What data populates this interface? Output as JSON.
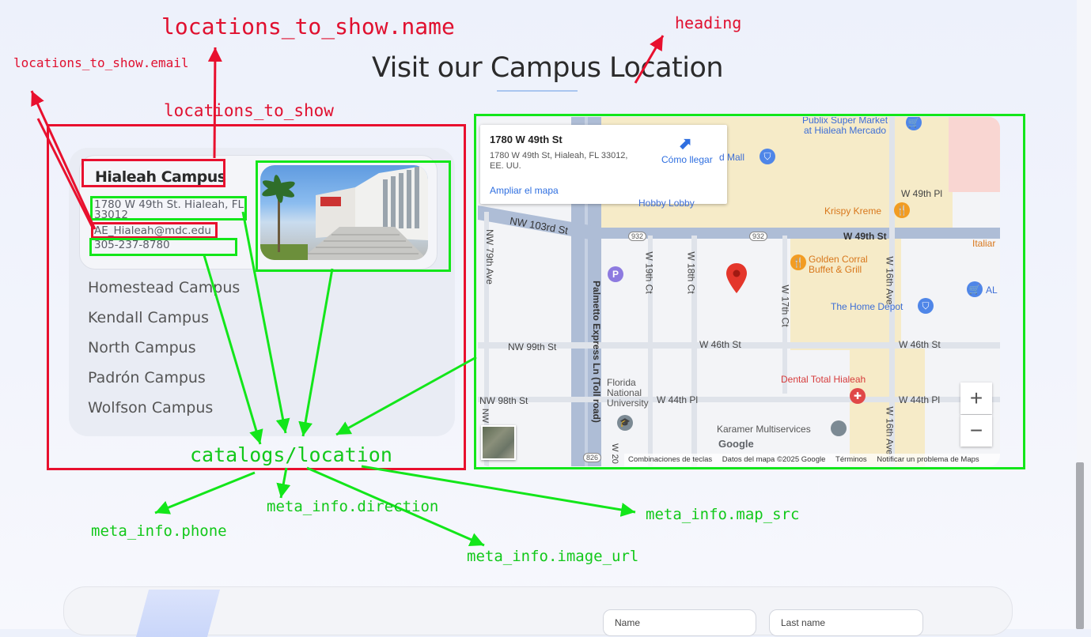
{
  "annotations": {
    "locations_name": "locations_to_show.name",
    "heading": "heading",
    "locations_email": "locations_to_show.email",
    "locations_to_show": "locations_to_show",
    "catalogs_location": "catalogs/location",
    "meta_phone": "meta_info.phone",
    "meta_direction": "meta_info.direction",
    "meta_image": "meta_info.image_url",
    "meta_map": "meta_info.map_src"
  },
  "section": {
    "heading": "Visit our Campus Location"
  },
  "active_campus": {
    "name": "Hialeah Campus",
    "address_line1": "1780 W 49th St. Hialeah, FL",
    "address_line2": "33012",
    "email": "AE_Hialeah@mdc.edu",
    "phone": "305-237-8780"
  },
  "campuses": [
    {
      "label": "Homestead Campus"
    },
    {
      "label": "Kendall Campus"
    },
    {
      "label": "North Campus"
    },
    {
      "label": "Padrón Campus"
    },
    {
      "label": "Wolfson Campus"
    }
  ],
  "map": {
    "info_title": "1780 W 49th St",
    "info_address": "1780 W 49th St, Hialeah, FL 33012,",
    "info_country": "EE. UU.",
    "directions_label": "Cómo llegar",
    "enlarge_label": "Ampliar el mapa",
    "streets": {
      "nw103": "NW 103rd St",
      "w49": "W 49th St",
      "w49pl": "W 49th Pl",
      "nw79": "NW 79th Ave",
      "palmetto": "Palmetto Express Ln (Toll road)",
      "w19ct": "W 19th Ct",
      "w18ct": "W 18th Ct",
      "w17ct": "W 17th Ct",
      "w16ave": "W 16th Ave",
      "w16ave2": "W 16th Ave",
      "nw99": "NW 99th St",
      "w46a": "W 46th St",
      "w46b": "W 46th St",
      "nw98": "NW 98th St",
      "w44pl": "W 44th Pl",
      "w44pl2": "W 44th Pl",
      "w20": "W 20",
      "nw_short": "NW",
      "shield932a": "932",
      "shield932b": "932",
      "shield826": "826"
    },
    "pois": {
      "publix1": "Publix Super Market",
      "publix2": "at Hialeah Mercado",
      "mall": "d Mall",
      "hobby": "Hobby Lobby",
      "krispy": "Krispy Kreme",
      "golden1": "Golden Corral",
      "golden2": "Buffet & Grill",
      "homedepot": "The Home Depot",
      "al": "AL",
      "italian": "Italiar",
      "dental": "Dental Total Hialeah",
      "fnu1": "Florida",
      "fnu2": "National",
      "fnu3": "University",
      "karamer": "Karamer Multiservices",
      "parking": "P"
    },
    "footer": {
      "shortcuts": "Combinaciones de teclas",
      "mapdata": "Datos del mapa ©2025 Google",
      "terms": "Términos",
      "report": "Notificar un problema de Maps",
      "google": "Google"
    },
    "zoom_in": "+",
    "zoom_out": "−"
  },
  "form": {
    "name_label": "Name",
    "lastname_label": "Last name"
  }
}
